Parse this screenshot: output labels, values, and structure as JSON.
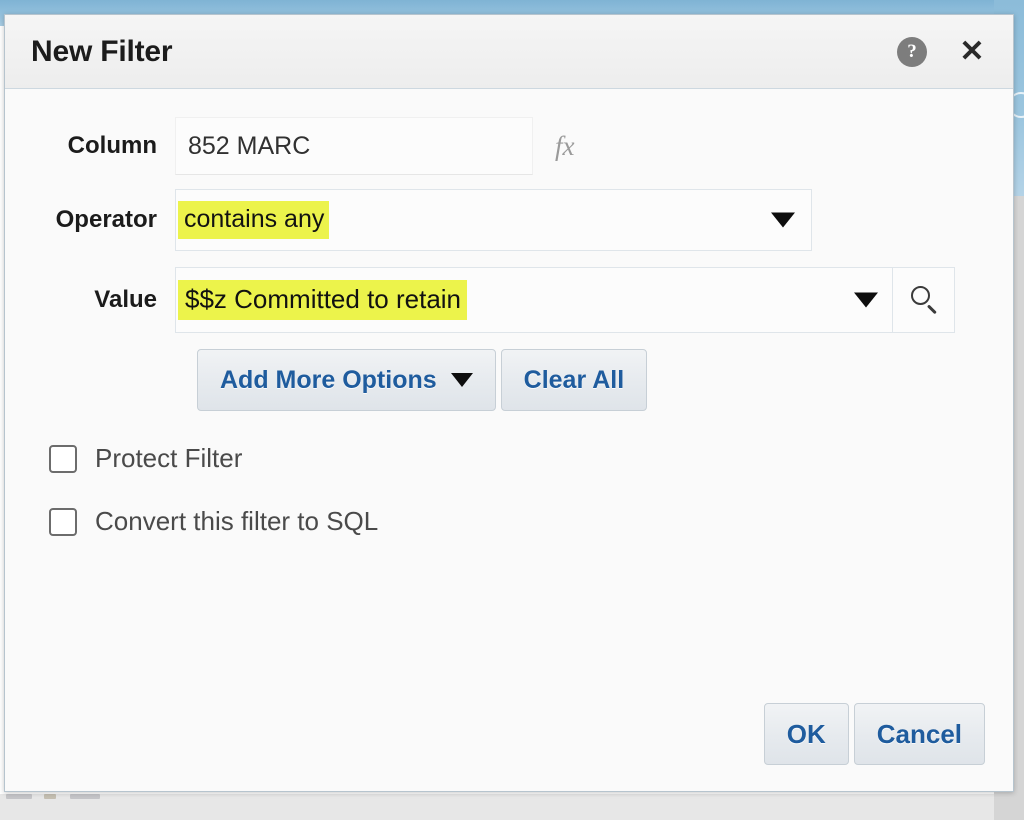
{
  "dialog": {
    "title": "New Filter",
    "help_icon": "help-circle-icon",
    "close_icon": "close-icon",
    "accent_color": "#1f5c9e",
    "highlight_color": "#ecf34b"
  },
  "form": {
    "column": {
      "label": "Column",
      "value": "852 MARC",
      "fx_icon": "fx-formula-icon"
    },
    "operator": {
      "label": "Operator",
      "value": "contains any",
      "caret_icon": "chevron-down-icon"
    },
    "value": {
      "label": "Value",
      "value": "$$z Committed to retain",
      "caret_icon": "chevron-down-icon",
      "search_icon": "search-icon"
    }
  },
  "options": {
    "add_more_label": "Add More Options",
    "add_more_caret": "chevron-down-icon",
    "clear_all_label": "Clear All"
  },
  "checkboxes": [
    {
      "label": "Protect Filter",
      "checked": false
    },
    {
      "label": "Convert this filter to SQL",
      "checked": false
    }
  ],
  "footer": {
    "ok_label": "OK",
    "cancel_label": "Cancel"
  }
}
